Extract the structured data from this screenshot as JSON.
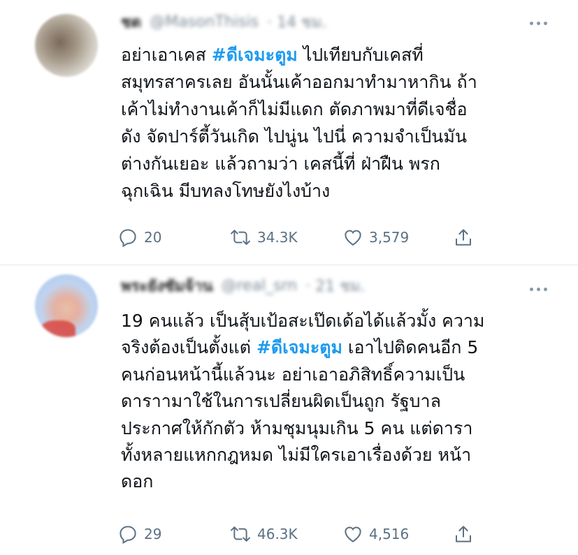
{
  "tweets": [
    {
      "display_name": "ชด",
      "handle": "@MasonThisis",
      "time": "· 14 ชม.",
      "text_lines": [
        {
          "before": "อย่าเอาเคส ",
          "hashtag": "#ดีเจมะตูม",
          "after": " ไปเทียบกับเคสที่"
        },
        {
          "before": "สมุทรสาครเลย อันนั้นเค้าออกมาทำมาหากิน ถ้า",
          "hashtag": "",
          "after": ""
        },
        {
          "before": "เค้าไม่ทำงานเค้าก็ไม่มีแดก ตัดภาพมาที่ดีเจชื่อ",
          "hashtag": "",
          "after": ""
        },
        {
          "before": "ดัง จัดปาร์ตี้วันเกิด ไปนู่น ไปนี่ ความจำเป็นมัน",
          "hashtag": "",
          "after": ""
        },
        {
          "before": "ต่างกันเยอะ แล้วถามว่า เคสนี้ที่ ฝ่าฝืน พรก",
          "hashtag": "",
          "after": ""
        },
        {
          "before": "ฉุกเฉิน มีบทลงโทษยังไงบ้าง",
          "hashtag": "",
          "after": ""
        }
      ],
      "replies": "20",
      "retweets": "34.3K",
      "likes": "3,579"
    },
    {
      "display_name": "พระยังซัมจ้าน",
      "handle": "@real_srn",
      "time": "· 21 ชม.",
      "text_lines": [
        {
          "before": "19 คนแล้ว เป็นสุ้บเป้อสะเป๊ดเด้อได้แล้วมั้ง ความ",
          "hashtag": "",
          "after": ""
        },
        {
          "before": "จริงต้องเป็นตั้งแต่ ",
          "hashtag": "#ดีเจมะตูม",
          "after": " เอาไปติดคนอีก 5"
        },
        {
          "before": "คนก่อนหน้านี้แล้วนะ อย่าเอาอภิสิทธิ์ความเป็น",
          "hashtag": "",
          "after": ""
        },
        {
          "before": "ดาราามาใช้ในการเปลี่ยนผิดเป็นถูก รัฐบาล",
          "hashtag": "",
          "after": ""
        },
        {
          "before": "ประกาศให้กักตัว ห้ามชุมนุมเกิน 5 คน แต่ดารา",
          "hashtag": "",
          "after": ""
        },
        {
          "before": "ทั้งหลายแหกกฎหมด ไม่มีใครเอาเรื่องด้วย หน้า",
          "hashtag": "",
          "after": ""
        },
        {
          "before": "ดอก",
          "hashtag": "",
          "after": ""
        }
      ],
      "replies": "29",
      "retweets": "46.3K",
      "likes": "4,516"
    }
  ],
  "icons": {
    "reply": "reply-icon",
    "retweet": "retweet-icon",
    "like": "heart-icon",
    "share": "share-icon",
    "more": "more-icon"
  },
  "colors": {
    "hashtag": "#1d9bf0",
    "icon": "#5b7083",
    "divider": "#e1e8ed"
  }
}
